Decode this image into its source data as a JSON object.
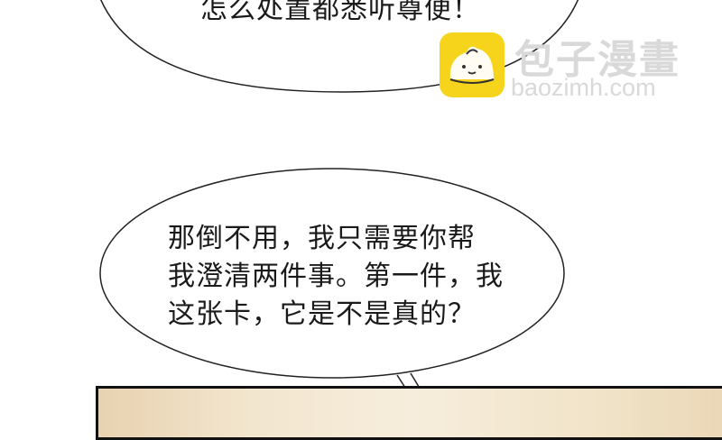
{
  "speech_bubbles": {
    "top": {
      "text": "怎么处置都悉听尊便！"
    },
    "middle": {
      "lines": [
        "那倒不用，我只需要你帮",
        "我澄清两件事。第一件，我",
        "这张卡，它是不是真的？"
      ]
    }
  },
  "watermark": {
    "title": "包子漫畫",
    "url": "baozimh.com",
    "icon": "steamed-bun-icon",
    "colors": {
      "icon_bg": "#f6d41c",
      "text": "#d9d9d9"
    }
  }
}
